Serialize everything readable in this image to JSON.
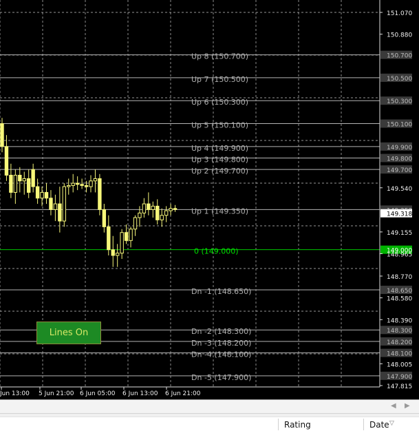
{
  "chart_data": {
    "type": "candlestick",
    "price_axis_labels": [
      "151.070",
      "150.880",
      "150.700",
      "150.500",
      "150.300",
      "150.100",
      "149.900",
      "149.800",
      "149.700",
      "149.540",
      "149.350",
      "149.318",
      "149.155",
      "149.000",
      "148.965",
      "148.770",
      "148.650",
      "148.580",
      "148.390",
      "148.300",
      "148.200",
      "148.100",
      "148.005",
      "147.900",
      "147.815"
    ],
    "highlighted_prices": [
      "150.700",
      "150.500",
      "150.300",
      "150.100",
      "149.900",
      "149.800",
      "149.700",
      "149.350",
      "148.650",
      "148.300",
      "148.200",
      "148.100",
      "147.900"
    ],
    "current_price": "149.318",
    "zero_line_price": "149.000",
    "time_labels": [
      "Jun 13:00",
      "5 Jun 21:00",
      "6 Jun 05:00",
      "6 Jun 13:00",
      "6 Jun 21:00"
    ],
    "levels": [
      {
        "label": "Up 8 (150.700)",
        "price": 150.7
      },
      {
        "label": "Up 7 (150.500)",
        "price": 150.5
      },
      {
        "label": "Up 6 (150.300)",
        "price": 150.3
      },
      {
        "label": "Up 5 (150.100)",
        "price": 150.1
      },
      {
        "label": "Up 4 (149.900)",
        "price": 149.9
      },
      {
        "label": "Up 3 (149.800)",
        "price": 149.8
      },
      {
        "label": "Up 2 (149.700)",
        "price": 149.7
      },
      {
        "label": "Up 1 (149.350)",
        "price": 149.35
      },
      {
        "label": "0 (149.000)",
        "price": 149.0
      },
      {
        "label": "Dn -1 (148.650)",
        "price": 148.65
      },
      {
        "label": "Dn -2 (148.300)",
        "price": 148.3
      },
      {
        "label": "Dn -3 (148.200)",
        "price": 148.2
      },
      {
        "label": "Dn -4 (148.100)",
        "price": 148.1
      },
      {
        "label": "Dn -5 (147.900)",
        "price": 147.9
      }
    ],
    "candles": [
      [
        150.1,
        150.15,
        149.85,
        149.9
      ],
      [
        149.9,
        150.0,
        149.6,
        149.65
      ],
      [
        149.65,
        149.75,
        149.45,
        149.5
      ],
      [
        149.5,
        149.7,
        149.4,
        149.65
      ],
      [
        149.65,
        149.72,
        149.5,
        149.6
      ],
      [
        149.6,
        149.68,
        149.48,
        149.62
      ],
      [
        149.62,
        149.7,
        149.45,
        149.5
      ],
      [
        149.7,
        149.75,
        149.5,
        149.55
      ],
      [
        149.55,
        149.62,
        149.4,
        149.45
      ],
      [
        149.45,
        149.55,
        149.38,
        149.5
      ],
      [
        149.5,
        149.58,
        149.4,
        149.45
      ],
      [
        149.45,
        149.52,
        149.3,
        149.35
      ],
      [
        149.35,
        149.48,
        149.25,
        149.4
      ],
      [
        149.4,
        149.55,
        149.15,
        149.25
      ],
      [
        149.25,
        149.58,
        149.2,
        149.55
      ],
      [
        149.55,
        149.62,
        149.48,
        149.56
      ],
      [
        149.56,
        149.66,
        149.5,
        149.58
      ],
      [
        149.58,
        149.64,
        149.52,
        149.57
      ],
      [
        149.57,
        149.62,
        149.53,
        149.56
      ],
      [
        149.56,
        149.6,
        149.5,
        149.55
      ],
      [
        149.55,
        149.65,
        149.5,
        149.6
      ],
      [
        149.6,
        149.7,
        149.5,
        149.62
      ],
      [
        149.62,
        149.66,
        149.3,
        149.35
      ],
      [
        149.35,
        149.4,
        149.15,
        149.2
      ],
      [
        149.2,
        149.3,
        148.95,
        149.0
      ],
      [
        149.0,
        149.12,
        148.85,
        148.95
      ],
      [
        148.95,
        149.05,
        148.85,
        148.97
      ],
      [
        148.97,
        149.18,
        148.92,
        149.15
      ],
      [
        149.15,
        149.22,
        149.05,
        149.08
      ],
      [
        149.08,
        149.2,
        149.02,
        149.18
      ],
      [
        149.18,
        149.3,
        149.12,
        149.28
      ],
      [
        149.28,
        149.38,
        149.2,
        149.32
      ],
      [
        149.32,
        149.45,
        149.28,
        149.4
      ],
      [
        149.4,
        149.5,
        149.3,
        149.35
      ],
      [
        149.35,
        149.42,
        149.28,
        149.38
      ],
      [
        149.38,
        149.44,
        149.22,
        149.26
      ],
      [
        149.26,
        149.36,
        149.2,
        149.3
      ],
      [
        149.3,
        149.38,
        149.24,
        149.34
      ],
      [
        149.34,
        149.4,
        149.3,
        149.36
      ],
      [
        149.36,
        149.39,
        149.33,
        149.35
      ]
    ]
  },
  "controls": {
    "lines_button_label": "Lines On"
  },
  "bottom_panel": {
    "scroll_left_icon": "left-arrow-icon",
    "scroll_right_icon": "right-arrow-icon",
    "columns": [
      "Rating",
      "Date"
    ],
    "sort_icon": "sort-triangle-icon"
  },
  "colors": {
    "background": "#000000",
    "grid": "#c8c8c8",
    "level_line": "#b4b4b4",
    "zero_line": "#00c800",
    "level_text": "#aeaeae",
    "zero_text": "#00e000",
    "candle": "#f7f77a"
  }
}
